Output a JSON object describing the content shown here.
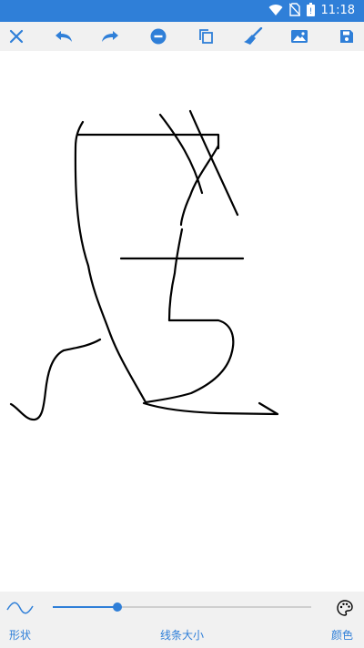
{
  "status_bar": {
    "time": "11:18",
    "icons": [
      "wifi-icon",
      "no-sim-icon",
      "battery-icon"
    ]
  },
  "toolbar": {
    "buttons": [
      "close-icon",
      "undo-icon",
      "redo-icon",
      "remove-icon",
      "copy-icon",
      "clear-brush-icon",
      "image-icon",
      "save-icon"
    ]
  },
  "bottom": {
    "shape_label": "形状",
    "size_label": "线条大小",
    "color_label": "颜色",
    "stroke_size_fraction": 0.25,
    "shape_icon": "wave-icon",
    "palette_icon": "palette-icon"
  },
  "colors": {
    "accent": "#2f7fd8",
    "toolbar_bg": "#f1f1f1",
    "ink": "#000000"
  }
}
